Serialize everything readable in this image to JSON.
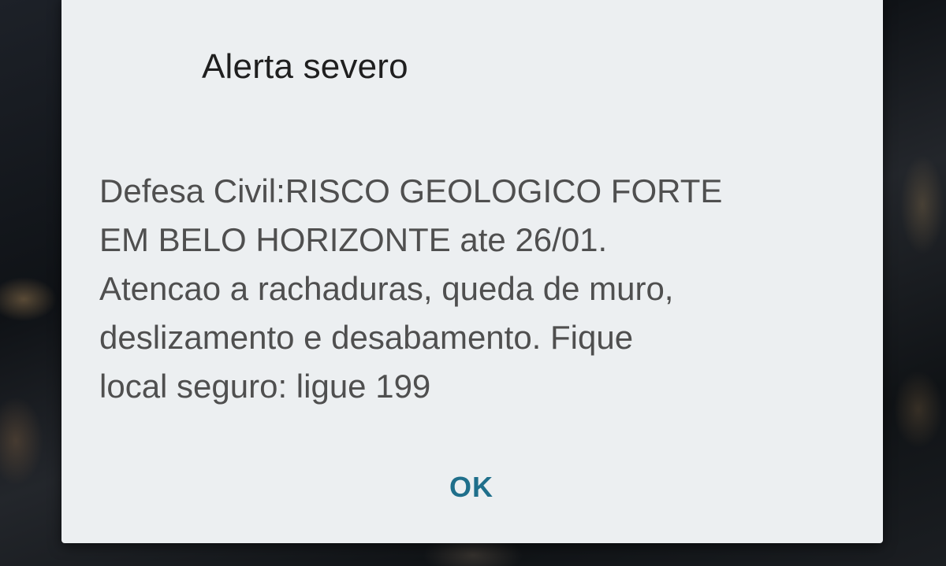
{
  "dialog": {
    "title": "Alerta severo",
    "message": "Defesa Civil:RISCO GEOLOGICO FORTE\nEM BELO HORIZONTE ate 26/01.\nAtencao a rachaduras, queda de muro,\ndeslizamento e desabamento. Fique\nlocal seguro: ligue 199",
    "ok_label": "OK"
  },
  "colors": {
    "dialog_background": "#eceff1",
    "title_text": "#1f1f1f",
    "message_text": "#4f4f4f",
    "button_accent": "#1f6f8b"
  }
}
